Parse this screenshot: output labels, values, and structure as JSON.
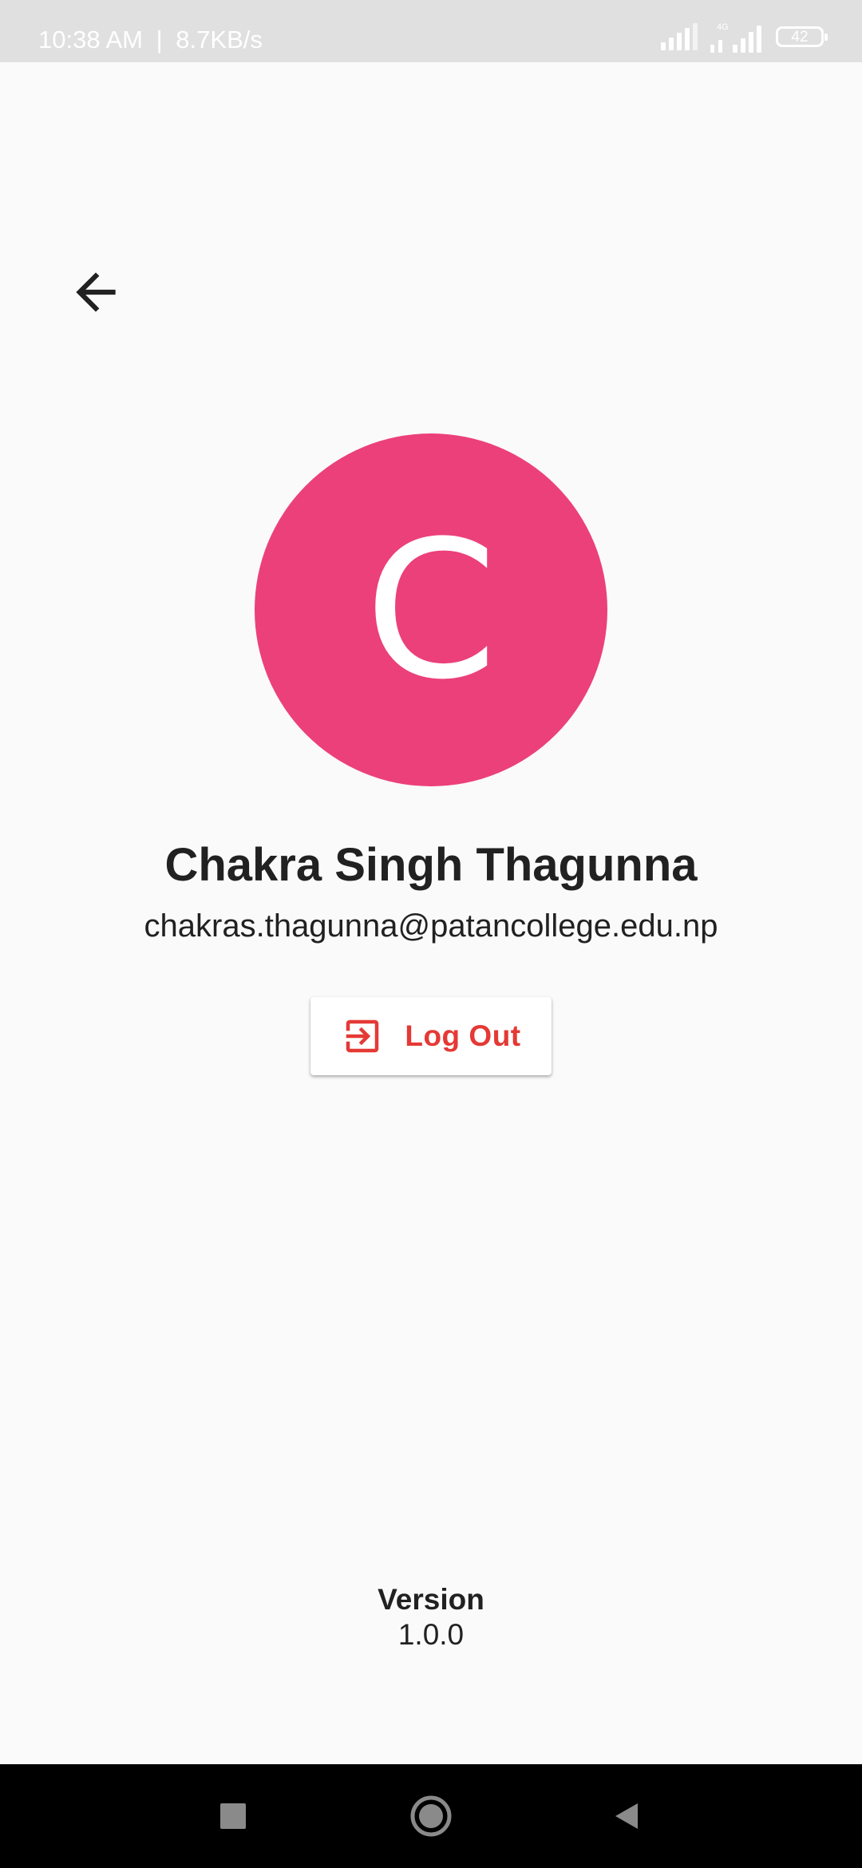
{
  "status_bar": {
    "time": "10:38 AM",
    "separator": "|",
    "network_speed": "8.7KB/s",
    "network_type": "4G",
    "battery_level": "42"
  },
  "header": {
    "back_icon": "arrow-left-icon"
  },
  "profile": {
    "avatar_letter": "C",
    "avatar_color": "#ec407a",
    "name": "Chakra Singh Thagunna",
    "email": "chakras.thagunna@patancollege.edu.np"
  },
  "logout": {
    "label": "Log Out",
    "icon": "logout-icon",
    "color": "#e53935"
  },
  "version": {
    "title": "Version",
    "value": "1.0.0"
  },
  "nav_bar": {
    "recents_icon": "square-icon",
    "home_icon": "circle-icon",
    "back_icon": "triangle-back-icon"
  }
}
